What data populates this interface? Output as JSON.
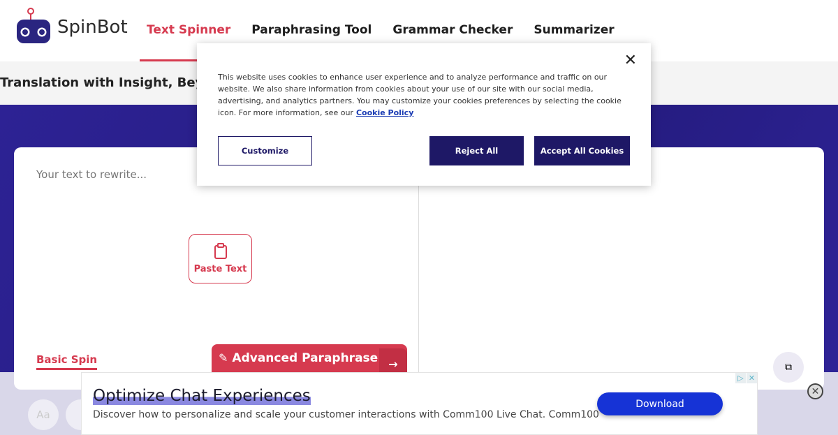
{
  "header": {
    "logo_text": "SpinBot",
    "nav": [
      "Text Spinner",
      "Paraphrasing Tool",
      "Grammar Checker",
      "Summarizer"
    ],
    "active": "Text Spinner"
  },
  "band": {
    "text": "Translation with Insight, Beyond"
  },
  "editor": {
    "placeholder": "Your text to rewrite...",
    "paste_label": "Paste Text",
    "basic_spin": "Basic Spin",
    "advanced": "Advanced Paraphrase",
    "aa": "Aa"
  },
  "cookie": {
    "message": "This website uses cookies to enhance user experience and to analyze performance and traffic on our website. We also share information from cookies about your use of our site with our social media, advertising, and analytics partners. You may customize your cookies preferences by selecting the cookie icon. For more information, see our",
    "policy_link": "Cookie Policy",
    "customize": "Customize",
    "reject": "Reject All",
    "accept": "Accept All Cookies"
  },
  "ad": {
    "title": "Optimize Chat Experiences",
    "description": "Discover how to personalize and scale your customer interactions with Comm100 Live Chat. Comm100",
    "cta": "Download"
  },
  "colors": {
    "accent": "#d63a4f",
    "brand_dark": "#1e1866",
    "purple": "#2d2294",
    "ad_button": "#1633d6"
  }
}
